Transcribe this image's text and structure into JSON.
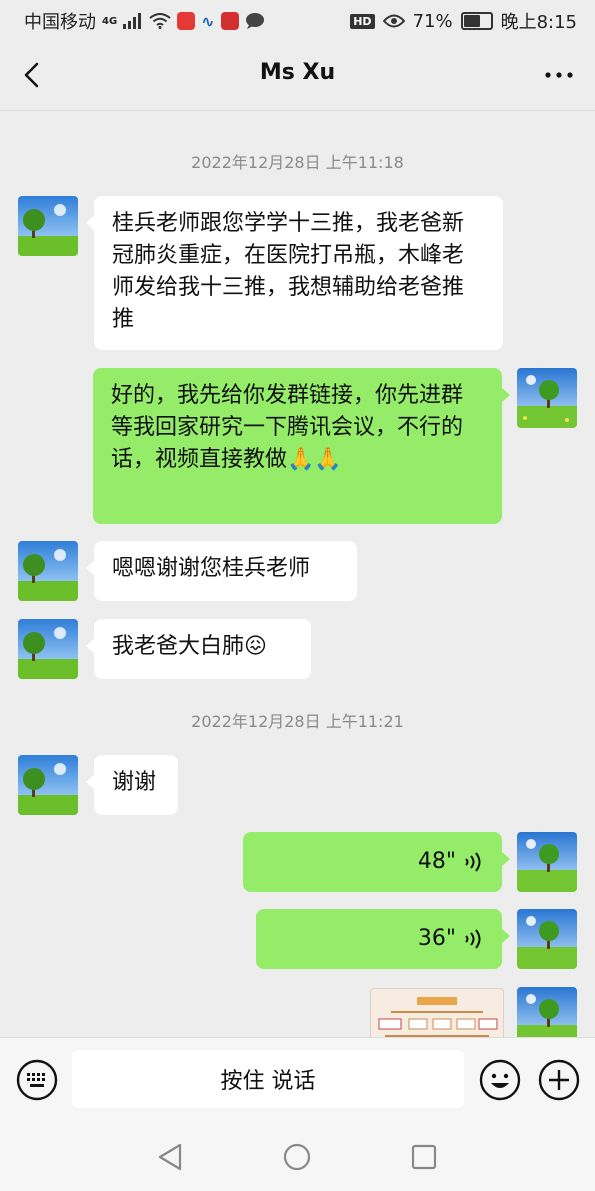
{
  "status_bar": {
    "carrier": "中国移动",
    "network": "4G",
    "battery": "71%",
    "battery_level": 0.71,
    "time": "晚上8:15",
    "hd": "HD"
  },
  "header": {
    "title": "Ms Xu"
  },
  "messages": [
    {
      "type": "timestamp",
      "text": "2022年12月28日 上午11:18"
    },
    {
      "type": "text",
      "direction": "in",
      "text": "桂兵老师跟您学学十三推，我老爸新冠肺炎重症，在医院打吊瓶，木峰老师发给我十三推，我想辅助给老爸推推"
    },
    {
      "type": "text",
      "direction": "out",
      "text_line1": "好的，我先给你发群链接，你先进群",
      "text_line2": "等我回家研究一下腾讯会议，不行的话，视频直接教做",
      "emoji": "🙏🙏"
    },
    {
      "type": "text",
      "direction": "in",
      "text": "嗯嗯谢谢您桂兵老师"
    },
    {
      "type": "text",
      "direction": "in",
      "text": "我老爸大白肺",
      "emoji": "😖"
    },
    {
      "type": "timestamp",
      "text": "2022年12月28日 上午11:21"
    },
    {
      "type": "text",
      "direction": "in",
      "text": "谢谢"
    },
    {
      "type": "voice",
      "direction": "out",
      "duration": "48\""
    },
    {
      "type": "voice",
      "direction": "out",
      "duration": "36\""
    },
    {
      "type": "image",
      "direction": "out"
    }
  ],
  "input_bar": {
    "talk_label": "按住 说话",
    "icons": [
      "keyboard-icon",
      "emoji-icon",
      "plus-icon"
    ]
  },
  "system_nav": {
    "icons": [
      "back-triangle-icon",
      "home-circle-icon",
      "recents-square-icon"
    ]
  },
  "colors": {
    "background": "#ededed",
    "outgoing_bubble": "#95ec69",
    "incoming_bubble": "#ffffff",
    "timestamp": "#8a8a8a"
  }
}
